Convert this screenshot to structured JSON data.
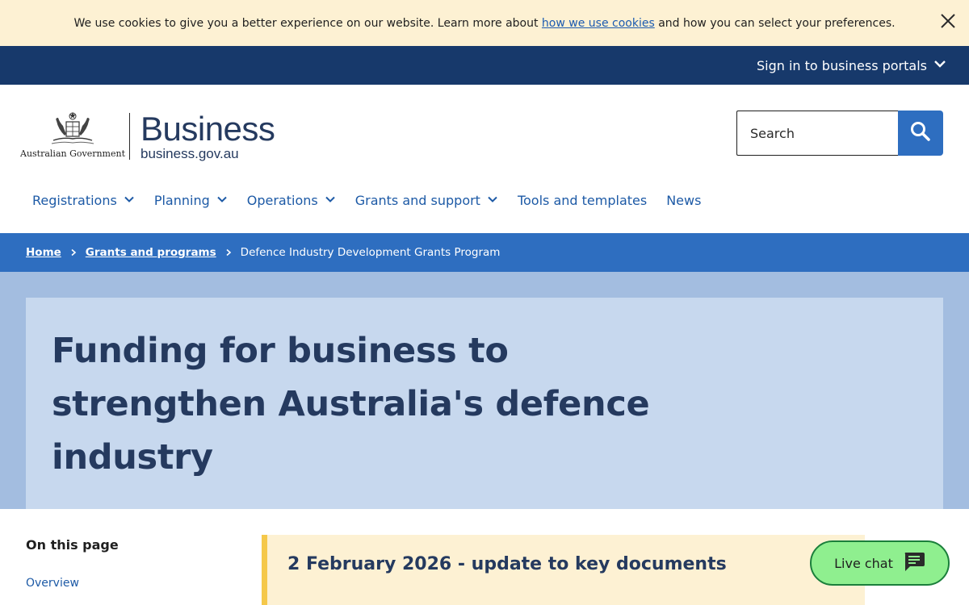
{
  "cookie": {
    "text_before": "We use cookies to give you a better experience on our website. Learn more about ",
    "link": "how we use cookies",
    "text_after": " and how you can select your preferences."
  },
  "portal_bar": {
    "label": "Sign in to business portals"
  },
  "logo": {
    "crest_label": "Australian Government",
    "title": "Business",
    "url": "business.gov.au"
  },
  "search": {
    "placeholder": "Search"
  },
  "nav": {
    "registrations": "Registrations",
    "planning": "Planning",
    "operations": "Operations",
    "grants": "Grants and support",
    "tools": "Tools and templates",
    "news": "News"
  },
  "breadcrumb": {
    "home": "Home",
    "grants": "Grants and programs",
    "current": "Defence Industry Development Grants Program"
  },
  "hero": {
    "title": "Funding for business to strengthen Australia's defence industry"
  },
  "on_this_page": {
    "title": "On this page",
    "items": [
      "Overview"
    ]
  },
  "update": {
    "text": "2 February 2026 - update to key documents"
  },
  "live_chat": {
    "label": "Live chat"
  },
  "colors": {
    "cookie_bg": "#fdf1d3",
    "portal_bar": "#17396b",
    "brand_blue": "#2e6ec0",
    "hero_outer": "#a3bde0",
    "hero_inner": "#c7d8ee",
    "chat_green": "#8fef8f"
  }
}
